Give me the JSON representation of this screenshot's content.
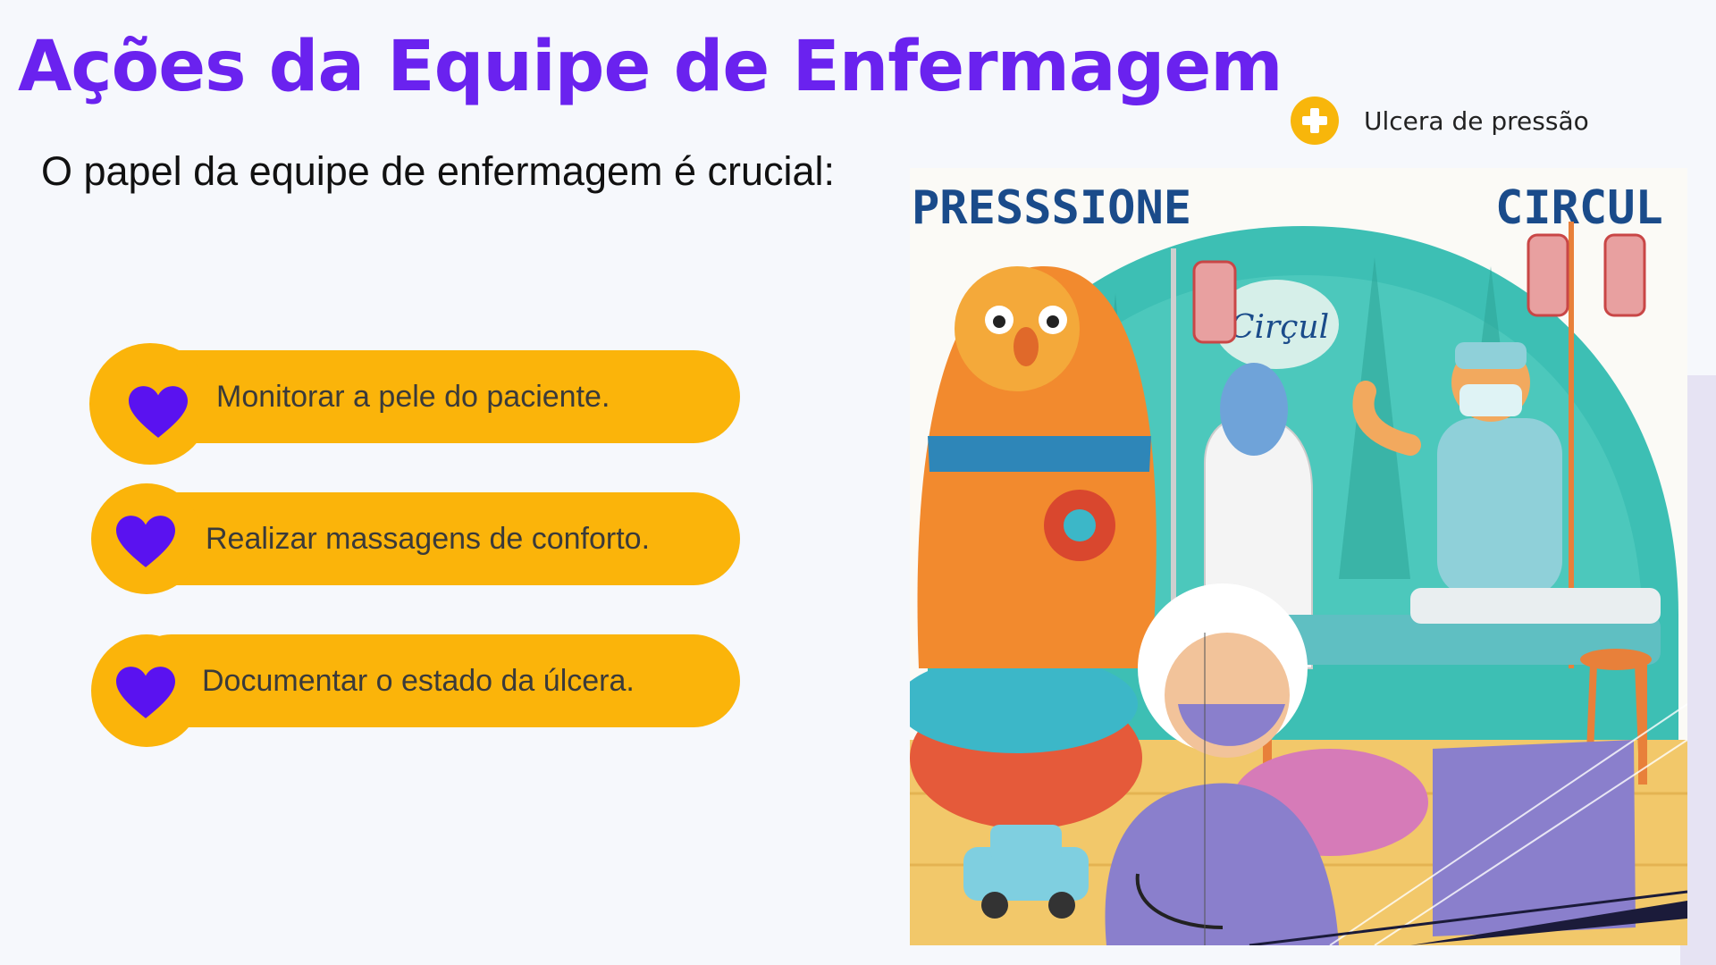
{
  "slide": {
    "title": "Ações da Equipe de Enfermagem",
    "subtitle": "O papel da equipe de enfermagem é crucial:",
    "badge": {
      "label": "Ulcera de pressão",
      "icon": "plus-circle-icon",
      "color": "#f8b60b"
    },
    "actions": [
      {
        "label": "Monitorar a pele do paciente.",
        "icon": "heart-icon"
      },
      {
        "label": "Realizar massagens de conforto.",
        "icon": "heart-icon"
      },
      {
        "label": "Documentar o estado da úlcera.",
        "icon": "heart-icon"
      }
    ],
    "illustration": {
      "text_left": "PRESSSIONE",
      "text_right": "CIRCUL",
      "bubble_text": "Cirçul"
    }
  },
  "colors": {
    "title": "#6a22ef",
    "accent": "#fbb40a",
    "heart": "#5a12f0",
    "background": "#f6f8fc"
  }
}
